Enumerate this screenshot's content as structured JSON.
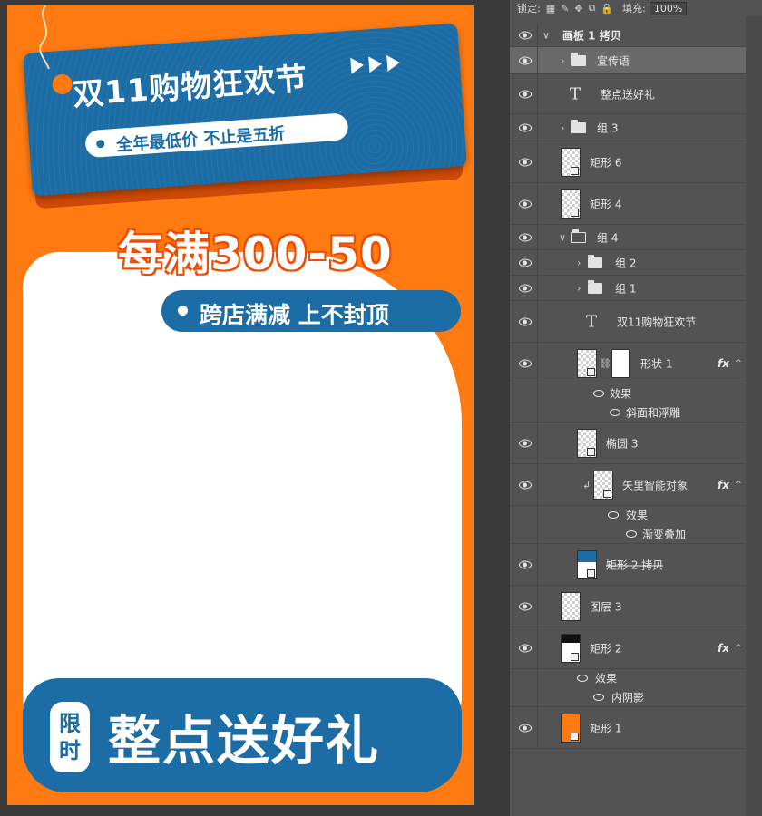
{
  "canvas": {
    "tag_title": "双11购物狂欢节",
    "tag_subtitle": "全年最低价  不止是五折",
    "promo_main": "每满300-50",
    "promo_pill": "跨店满减  上不封顶",
    "badge_line1": "限",
    "badge_line2": "时",
    "bottom_text": "整点送好礼"
  },
  "toolbar": {
    "lock_label": "锁定:",
    "fill_label": "填充:",
    "fill_value": "100%"
  },
  "layers": {
    "artboard": "画板 1 拷贝",
    "promo_group": "宣传语",
    "text_gift": "整点送好礼",
    "group3": "组 3",
    "rect6": "矩形 6",
    "rect4": "矩形 4",
    "group4": "组 4",
    "group2": "组 2",
    "group1": "组 1",
    "text_title": "双11购物狂欢节",
    "shape1": "形状 1",
    "effects_label_1": "效果",
    "effect_bevel": "斜面和浮雕",
    "ellipse3": "椭圆 3",
    "smart_object": "矢里智能对象",
    "effects_label_2": "效果",
    "effect_gradient": "渐变叠加",
    "rect2copy": "矩形 2 拷贝",
    "layer3": "图层 3",
    "rect2": "矩形 2",
    "effects_label_3": "效果",
    "effect_inner_shadow": "内阴影",
    "rect1": "矩形 1",
    "fx_label": "fx"
  },
  "colors": {
    "orange": "#ff7b12",
    "blue": "#1c6ca5",
    "panel_bg": "#535353",
    "selected_row": "#696969"
  }
}
